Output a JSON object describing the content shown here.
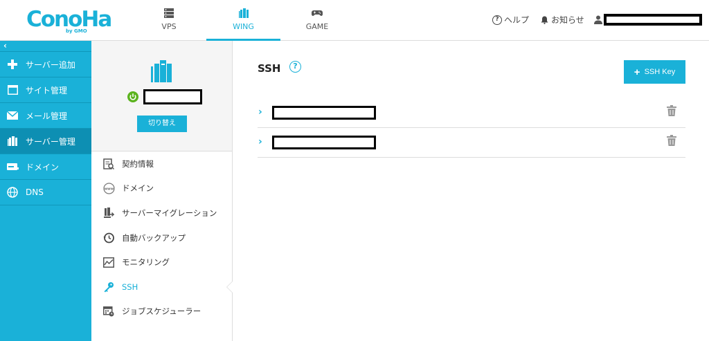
{
  "brand": {
    "logo_text": "ConoHa",
    "logo_sub": "by GMO",
    "brand_color": "#1ab1d8"
  },
  "top_nav": {
    "tabs": [
      {
        "label": "VPS",
        "icon": "server-rack-icon"
      },
      {
        "label": "WING",
        "icon": "wing-server-icon",
        "active": true
      },
      {
        "label": "GAME",
        "icon": "gamepad-icon"
      }
    ],
    "help_label": "ヘルプ",
    "notice_label": "お知らせ",
    "user_name": ""
  },
  "sidebar": {
    "collapse_glyph": "‹",
    "items": [
      {
        "label": "サーバー追加",
        "icon": "plus-icon"
      },
      {
        "label": "サイト管理",
        "icon": "window-icon"
      },
      {
        "label": "メール管理",
        "icon": "mail-icon"
      },
      {
        "label": "サーバー管理",
        "icon": "server-icon",
        "active": true
      },
      {
        "label": "ドメイン",
        "icon": "domain-icon"
      },
      {
        "label": "DNS",
        "icon": "globe-icon"
      }
    ]
  },
  "server_panel": {
    "server_name": "",
    "status": "running",
    "switch_label": "切り替え",
    "menu": [
      {
        "label": "契約情報",
        "icon": "contract-icon"
      },
      {
        "label": "ドメイン",
        "icon": "www-icon"
      },
      {
        "label": "サーバーマイグレーション",
        "icon": "migration-icon"
      },
      {
        "label": "自動バックアップ",
        "icon": "backup-icon"
      },
      {
        "label": "モニタリング",
        "icon": "monitoring-icon"
      },
      {
        "label": "SSH",
        "icon": "key-icon",
        "active": true
      },
      {
        "label": "ジョブスケジューラー",
        "icon": "scheduler-icon"
      }
    ]
  },
  "main": {
    "title": "SSH",
    "help_glyph": "?",
    "add_button_label": "SSH Key",
    "keys": [
      {
        "name": ""
      },
      {
        "name": ""
      }
    ]
  }
}
